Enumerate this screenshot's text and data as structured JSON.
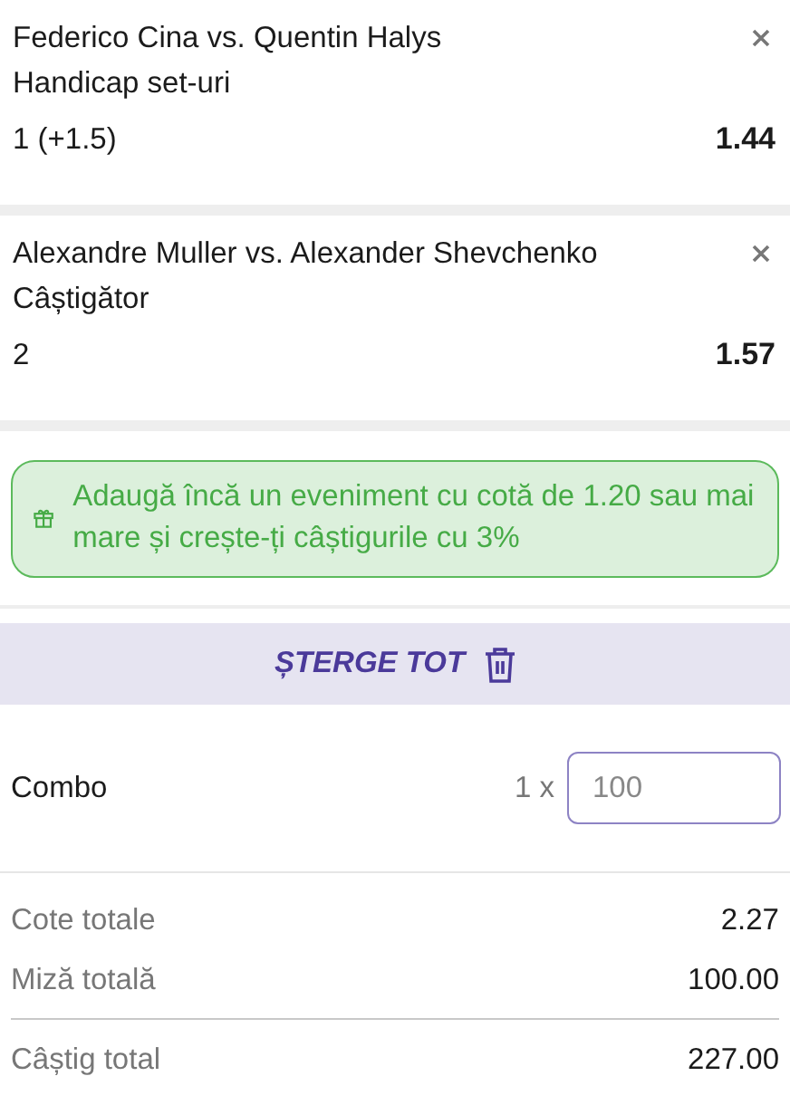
{
  "selections": [
    {
      "match": "Federico Cina vs. Quentin Halys",
      "market": "Handicap set-uri",
      "pick": "1 (+1.5)",
      "odds": "1.44"
    },
    {
      "match": "Alexandre Muller vs. Alexander Shevchenko",
      "market": "Câștigător",
      "pick": "2",
      "odds": "1.57"
    }
  ],
  "promo": {
    "text": "Adaugă încă un eveniment cu cotă de 1.20 sau mai mare și crește-ți câștigurile cu 3%"
  },
  "clear_all": {
    "label": "ȘTERGE TOT"
  },
  "stake": {
    "label": "Combo",
    "multiplier": "1 x",
    "placeholder": "100"
  },
  "totals": [
    {
      "label": "Cote totale",
      "value": "2.27",
      "kind": "line"
    },
    {
      "label": "Miză totală",
      "value": "100.00",
      "kind": "line"
    },
    {
      "label": "Câștig total",
      "value": "227.00",
      "kind": "result"
    }
  ]
}
